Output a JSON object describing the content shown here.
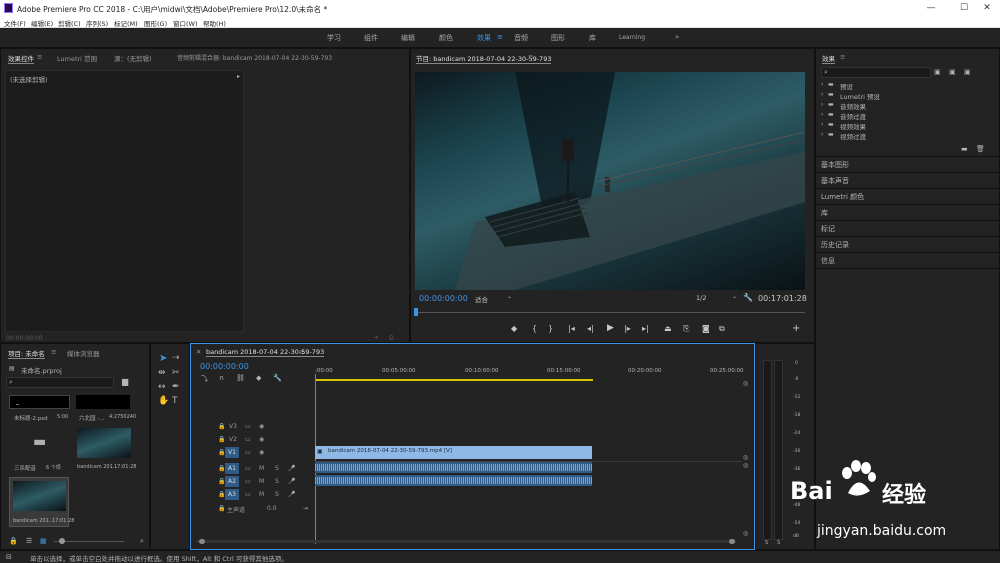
{
  "window": {
    "title": "Adobe Premiere Pro CC 2018 - C:\\用户\\midwi\\文档\\Adobe\\Premiere Pro\\12.0\\未命名 *",
    "minimize": "—",
    "maximize": "☐",
    "close": "✕"
  },
  "menu": [
    "文件(F)",
    "编辑(E)",
    "剪辑(C)",
    "序列(S)",
    "标记(M)",
    "图形(G)",
    "窗口(W)",
    "帮助(H)"
  ],
  "workspaces": {
    "items": [
      "学习",
      "组件",
      "编辑",
      "颜色",
      "效果",
      "音频",
      "图形",
      "库",
      "Learning"
    ],
    "active": "效果",
    "more": "»"
  },
  "effect_controls": {
    "tabs": [
      "效果控件",
      "Lumetri 范围",
      "源：(无剪辑)",
      "音频剪辑混合器: bandicam 2018-07-04 22-30-59-793"
    ],
    "no_clip": "(未选择剪辑)",
    "timecode": "00:00:00:00"
  },
  "program": {
    "title": "节目: bandicam 2018-07-04 22-30-59-793",
    "timecode": "00:00:00:00",
    "fit": "适合",
    "quality": "1/2",
    "duration": "00:17:01:28"
  },
  "project": {
    "tabs": [
      "项目: 未命名",
      "媒体浏览器"
    ],
    "file": "未命名.prproj",
    "items": [
      {
        "name": "未标题-2.psd",
        "meta": "5:00"
      },
      {
        "name": "六北园 -...",
        "meta": "4:2750240"
      },
      {
        "name": "三杀配音",
        "meta": "6 个项"
      },
      {
        "name": "bandicam 201...",
        "meta": "17:01:28"
      },
      {
        "name": "bandicam 201...",
        "meta": "17:01:28"
      }
    ]
  },
  "timeline": {
    "title": "bandicam 2018-07-04 22-30-59-793",
    "timecode": "00:00:00:00",
    "ruler": [
      ":00:00",
      "00:05:00:00",
      "00:10:00:00",
      "00:15:00:00",
      "00:20:00:00",
      "00:25:00:00"
    ],
    "video_tracks": [
      "V3",
      "V2",
      "V1"
    ],
    "audio_tracks": [
      "A1",
      "A2",
      "A3"
    ],
    "master": "主声道",
    "master_value": "0.0",
    "clip_video": "bandicam 2018-07-04 22-30-59-793.mp4 [V]",
    "track_m": "M",
    "track_s": "S"
  },
  "meter": {
    "scale": [
      "0",
      "-6",
      "-12",
      "-18",
      "-24",
      "-30",
      "-36",
      "-42",
      "-48",
      "-54",
      "dB"
    ],
    "solo": "S"
  },
  "effects_panel": {
    "title": "效果",
    "folders": [
      "预设",
      "Lumetri 预设",
      "音频效果",
      "音频过渡",
      "视频效果",
      "视频过渡"
    ],
    "sections": [
      "基本图形",
      "基本声音",
      "Lumetri 颜色",
      "库",
      "标记",
      "历史记录",
      "信息"
    ]
  },
  "status": {
    "text": "单击以选择，或单击空白处并拖动以进行框选。使用 Shift，Alt 和 Ctrl 可获得其他选项。"
  },
  "watermark": {
    "brand": "Bai",
    "brand2": "经验",
    "url": "jingyan.baidu.com"
  }
}
